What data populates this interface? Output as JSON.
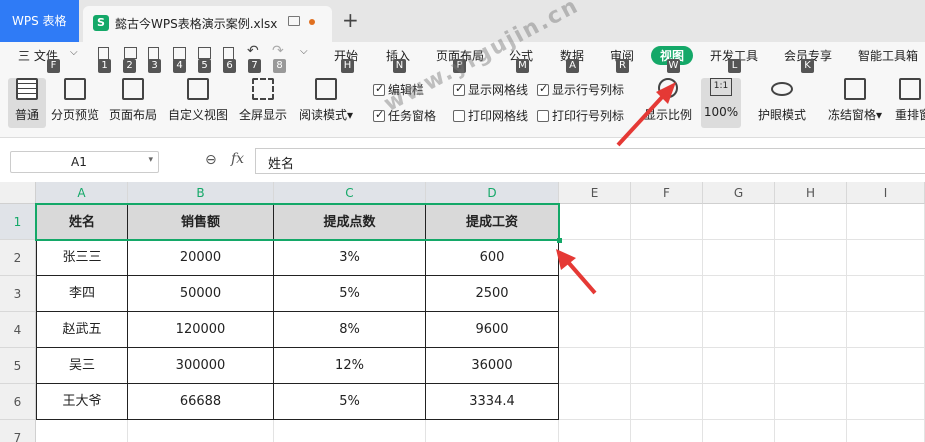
{
  "app": {
    "brand": "WPS 表格"
  },
  "tab": {
    "icon_letter": "S",
    "document_name": "懿古今WPS表格演示案例.xlsx"
  },
  "menus": [
    {
      "label": "三 文件",
      "key": "F"
    },
    {
      "label": "开始",
      "key": "H"
    },
    {
      "label": "插入",
      "key": "N"
    },
    {
      "label": "页面布局",
      "key": "P"
    },
    {
      "label": "公式",
      "key": "M"
    },
    {
      "label": "数据",
      "key": "A"
    },
    {
      "label": "审阅",
      "key": "R"
    },
    {
      "label": "视图",
      "key": "W",
      "active": true
    },
    {
      "label": "开发工具",
      "key": "L"
    },
    {
      "label": "会员专享",
      "key": "K"
    },
    {
      "label": "智能工具箱",
      "key": ""
    }
  ],
  "quick_keys": [
    "1",
    "2",
    "3",
    "4",
    "5",
    "6",
    "7",
    "8"
  ],
  "toolbar": {
    "normal": "普通",
    "page_break_preview": "分页预览",
    "page_layout": "页面布局",
    "custom_view": "自定义视图",
    "full_screen": "全屏显示",
    "reading_mode": "阅读模式",
    "zoom_ratio": "显示比例",
    "zoom_100_icon": "1:1",
    "zoom_100": "100%",
    "eye_protection": "护眼模式",
    "freeze_panes": "冻结窗格",
    "rearrange": "重排窗"
  },
  "checkboxes": [
    {
      "label": "编辑栏",
      "checked": true
    },
    {
      "label": "任务窗格",
      "checked": true
    },
    {
      "label": "显示网格线",
      "checked": true
    },
    {
      "label": "打印网格线",
      "checked": false
    },
    {
      "label": "显示行号列标",
      "checked": true
    },
    {
      "label": "打印行号列标",
      "checked": false
    }
  ],
  "formula_bar": {
    "name_box": "A1",
    "fx": "fx",
    "value": "姓名"
  },
  "columns": [
    "A",
    "B",
    "C",
    "D",
    "E",
    "F",
    "G",
    "H",
    "I"
  ],
  "rows": [
    "1",
    "2",
    "3",
    "4",
    "5",
    "6",
    "7"
  ],
  "table": {
    "headers": [
      "姓名",
      "销售额",
      "提成点数",
      "提成工资"
    ],
    "data": [
      [
        "张三三",
        "20000",
        "3%",
        "600"
      ],
      [
        "李四",
        "50000",
        "5%",
        "2500"
      ],
      [
        "赵武五",
        "120000",
        "8%",
        "9600"
      ],
      [
        "吴三",
        "300000",
        "12%",
        "36000"
      ],
      [
        "王大爷",
        "66688",
        "5%",
        "3334.4"
      ]
    ]
  },
  "watermark": "www.yigujin.cn",
  "colors": {
    "accent_green": "#14a868",
    "brand_blue": "#2f7bf6",
    "arrow_red": "#e53935"
  }
}
